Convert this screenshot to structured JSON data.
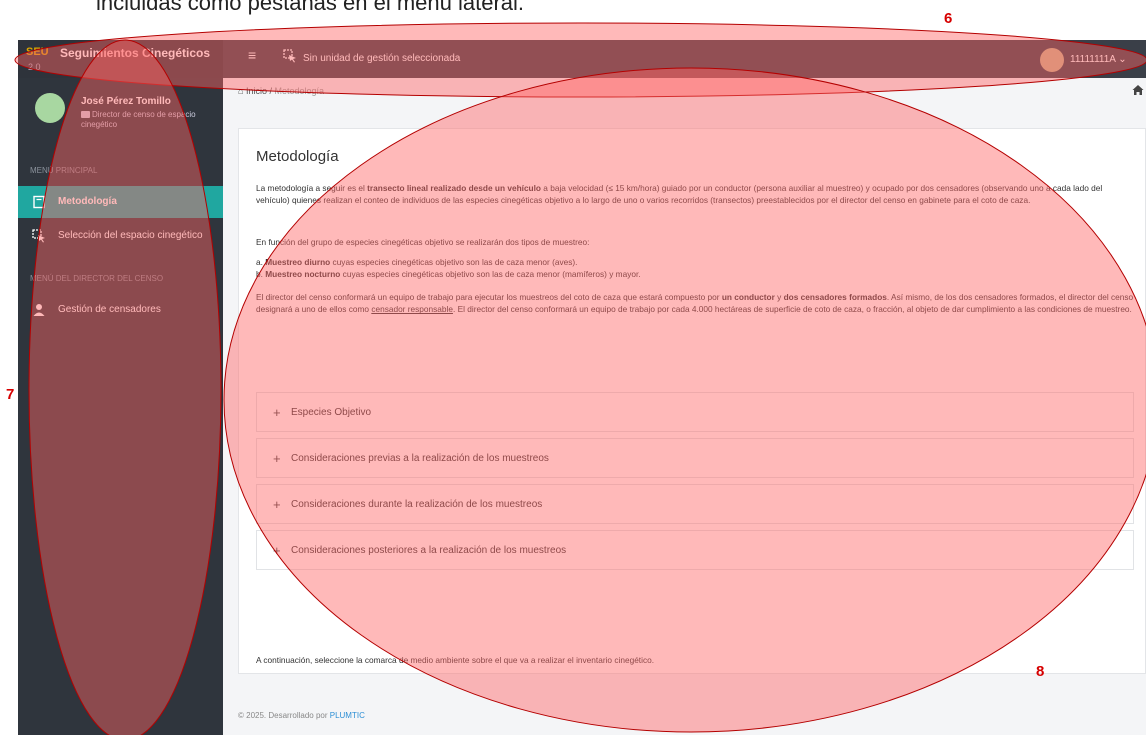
{
  "caption": "incluidas como pestañas en el menú lateral.",
  "brand": {
    "logo": "SEU",
    "title": "Seguimientos Cinegéticos",
    "sub": "2.0"
  },
  "topbar": {
    "unit_text": "Sin unidad de gestión seleccionada",
    "user": "11111111A"
  },
  "sidebar": {
    "profile_name": "José Pérez Tomillo",
    "profile_role": "Director de censo de espacio cinegético",
    "section_main": "MENÚ PRINCIPAL",
    "section_director": "MENÚ DEL DIRECTOR DEL CENSO",
    "items": [
      {
        "label": "Metodología"
      },
      {
        "label": "Selección del espacio cinegético"
      },
      {
        "label": "Gestión de censadores"
      }
    ]
  },
  "breadcrumb": {
    "home": "Inicio",
    "sep": "/",
    "current": "Metodología"
  },
  "main": {
    "title": "Metodología",
    "p1_a": "La metodología a seguir es el ",
    "p1_b": "transecto lineal realizado desde un vehículo",
    "p1_c": " a baja velocidad (≤ 15 km/hora) guiado por un conductor (persona auxiliar al muestreo) y ocupado por dos censadores (observando uno a cada lado del vehículo) quienes realizan el conteo de individuos de las especies cinegéticas objetivo a lo largo de uno o varios recorridos (transectos) preestablecidos por el director del censo en gabinete para el coto de caza.",
    "p2": "En función del grupo de especies cinegéticas objetivo se realizarán dos tipos de muestreo:",
    "li1_a": "Muestreo diurno",
    "li1_b": " cuyas especies cinegéticas objetivo son las de caza menor (aves).",
    "li2_a": "Muestreo nocturno",
    "li2_b": " cuyas especies cinegéticas objetivo son las de caza menor (mamíferos) y mayor.",
    "p3_a": "El director del censo conformará un equipo de trabajo para ejecutar los muestreos del coto de caza que estará compuesto por ",
    "p3_b": "un conductor",
    "p3_c": " y ",
    "p3_d": "dos censadores formados",
    "p3_e": ". Así mismo, de los dos censadores formados, el director del censo designará a uno de ellos como ",
    "p3_f": "censador responsable",
    "p3_g": ". El director del censo conformará un equipo de trabajo por cada 4.000 hectáreas de superficie de coto de caza, o fracción, al objeto de dar cumplimiento a las condiciones de muestreo.",
    "accordions": [
      {
        "label": "Especies Objetivo"
      },
      {
        "label": "Consideraciones previas a la realización de los muestreos"
      },
      {
        "label": "Consideraciones durante la realización de los muestreos"
      },
      {
        "label": "Consideraciones posteriores a la realización de los muestreos"
      }
    ],
    "footnote": "A continuación, seleccione la comarca de medio ambiente sobre el que va a realizar el inventario cinegético."
  },
  "footer": {
    "text": "© 2025. Desarrollado por ",
    "link": "PLUMTIC"
  },
  "markers": {
    "six": "6",
    "seven": "7",
    "eight": "8"
  },
  "colors": {
    "sidebar": "#2f353d",
    "active": "#20a7a0",
    "highlight": "#ff7f7f",
    "annotation": "#d60000"
  }
}
